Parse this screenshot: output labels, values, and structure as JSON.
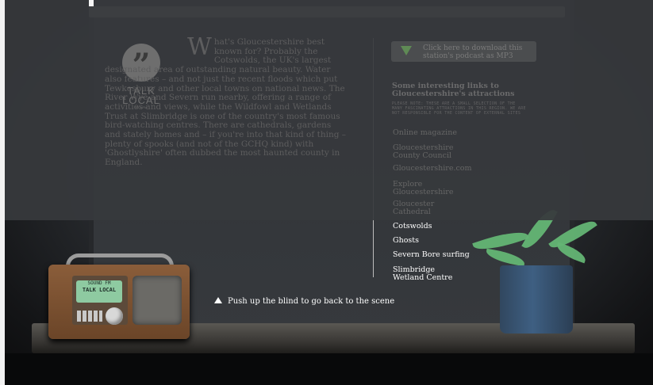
{
  "logo": {
    "text_line1": "TALK",
    "text_line2": "LOCAL",
    "subtitle": "99.9 FM"
  },
  "article": {
    "dropcap": "W",
    "text": "hat's Gloucestershire best known for? Probably the Cotswolds, the UK's largest designated area of outstanding natural beauty. Water also features – and not just the recent floods which put Tewkesbury and other local towns on national news. The River Wye and Severn run nearby, offering a range of activities and views, while the Wildfowl and Wetlands Trust at Slimbridge is one of the country's most famous bird-watching centres. There are cathedrals, gardens and stately homes and – if you're into that kind of thing – plenty of spooks (and not of the GCHQ kind) with 'Ghostlyshire' often dubbed the most haunted county in England."
  },
  "download": {
    "label": "Click here to download this station's podcast as MP3"
  },
  "links": {
    "title": "Some interesting links to Gloucestershire's attractions",
    "intro": "PLEASE NOTE: THESE ARE A SMALL SELECTION OF THE MANY FASCINATING ATTRACTIONS IN THIS REGION. WE ARE NOT RESPONSIBLE FOR THE CONTENT OF EXTERNAL SITES",
    "items": [
      {
        "label": "Online magazine"
      },
      {
        "label": "Gloucestershire County Council"
      },
      {
        "label": "Gloucestershire.com"
      },
      {
        "label": "Explore Gloucestershire"
      },
      {
        "label": "Gloucester Cathedral"
      },
      {
        "label": "Cotswolds"
      },
      {
        "label": "Ghosts"
      },
      {
        "label": "Severn Bore surfing"
      },
      {
        "label": "Slimbridge Wetland Centre"
      }
    ]
  },
  "radio": {
    "screen_line1": "SOUND FM",
    "screen_line2": "TALK LOCAL"
  },
  "hint": {
    "text": "Push up the blind to go back to the scene"
  }
}
